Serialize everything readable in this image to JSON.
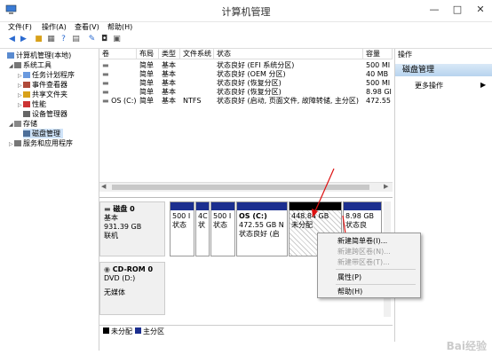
{
  "window": {
    "title": "计算机管理",
    "minimize": "—",
    "maximize": "□",
    "close": "✕"
  },
  "menubar": {
    "items": [
      "文件(F)",
      "操作(A)",
      "查看(V)",
      "帮助(H)"
    ]
  },
  "toolbar": {
    "icons": [
      "back-icon",
      "forward-icon",
      "folder-icon",
      "properties-icon",
      "help-icon",
      "view-icon",
      "settings-icon",
      "disk-icon",
      "delete-icon"
    ]
  },
  "tree": {
    "root": "计算机管理(本地)",
    "system_tools": "系统工具",
    "task_scheduler": "任务计划程序",
    "event_viewer": "事件查看器",
    "shared_folders": "共享文件夹",
    "performance": "性能",
    "device_manager": "设备管理器",
    "storage": "存储",
    "disk_management": "磁盘管理",
    "services": "服务和应用程序"
  },
  "volume_table": {
    "headers": [
      "卷",
      "布局",
      "类型",
      "文件系统",
      "状态",
      "容量"
    ],
    "rows": [
      {
        "vol": "",
        "layout": "简单",
        "type": "基本",
        "fs": "",
        "status": "状态良好 (EFI 系统分区)",
        "capacity": "500 MI"
      },
      {
        "vol": "",
        "layout": "简单",
        "type": "基本",
        "fs": "",
        "status": "状态良好 (OEM 分区)",
        "capacity": "40 MB"
      },
      {
        "vol": "",
        "layout": "简单",
        "type": "基本",
        "fs": "",
        "status": "状态良好 (恢复分区)",
        "capacity": "500 MI"
      },
      {
        "vol": "",
        "layout": "简单",
        "type": "基本",
        "fs": "",
        "status": "状态良好 (恢复分区)",
        "capacity": "8.98 GI"
      },
      {
        "vol": "OS (C:)",
        "layout": "简单",
        "type": "基本",
        "fs": "NTFS",
        "status": "状态良好 (启动, 页面文件, 故障转储, 主分区)",
        "capacity": "472.55"
      }
    ]
  },
  "disk0": {
    "name": "磁盘 0",
    "type": "基本",
    "size": "931.39 GB",
    "status": "联机"
  },
  "partitions": {
    "p1": {
      "l1": "500 I",
      "l2": "状态"
    },
    "p2": {
      "l1": "4C",
      "l2": "状"
    },
    "p3": {
      "l1": "500 I",
      "l2": "状态"
    },
    "os": {
      "l1": "OS  (C:)",
      "l2": "472.55 GB N",
      "l3": "状态良好 (启"
    },
    "unalloc": {
      "l1": "448.84 GB",
      "l2": "未分配"
    },
    "p6": {
      "l1": "8.98 GB",
      "l2": "状态良"
    }
  },
  "cdrom": {
    "name": "CD-ROM 0",
    "drive": "DVD (D:)",
    "status": "无媒体"
  },
  "legend": {
    "unallocated": "未分配",
    "primary": "主分区",
    "unallocated_color": "#000000",
    "primary_color": "#1c2f8f"
  },
  "actions": {
    "header": "操作",
    "section": "磁盘管理",
    "more": "更多操作"
  },
  "context_menu": {
    "new_simple": "新建简单卷(I)...",
    "new_spanned": "新建跨区卷(N)...",
    "new_striped": "新建带区卷(T)...",
    "properties": "属性(P)",
    "help": "帮助(H)"
  },
  "watermark": "Bai经验"
}
